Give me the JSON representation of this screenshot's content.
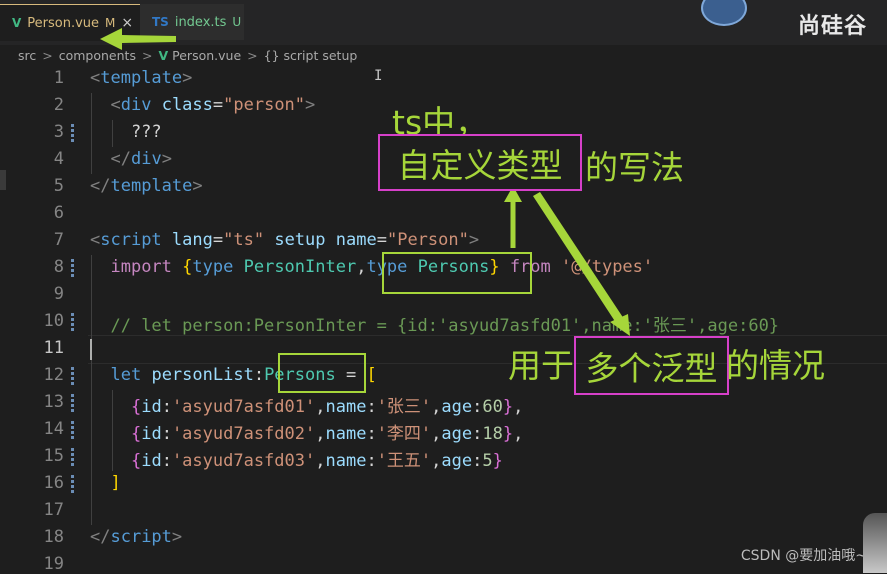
{
  "tabs": [
    {
      "icon": "V",
      "label": "Person.vue",
      "status": "M",
      "close": "×"
    },
    {
      "icon": "TS",
      "label": "index.ts",
      "status": "U"
    }
  ],
  "brand": "尚硅谷",
  "breadcrumb": {
    "items": [
      "src",
      "components",
      "Person.vue",
      "script setup"
    ],
    "separator": ">",
    "braces": "{}"
  },
  "editor": {
    "current_line": 11,
    "line_numbers": [
      "1",
      "2",
      "3",
      "4",
      "5",
      "6",
      "7",
      "8",
      "9",
      "10",
      "11",
      "12",
      "13",
      "14",
      "15",
      "16",
      "17",
      "18",
      "19"
    ],
    "lines": [
      [
        [
          "punc",
          "<"
        ],
        [
          "tag",
          "template"
        ],
        [
          "punc",
          ">"
        ]
      ],
      [
        [
          "txt",
          "  "
        ],
        [
          "punc",
          "<"
        ],
        [
          "tag",
          "div"
        ],
        [
          "txt",
          " "
        ],
        [
          "attr",
          "class"
        ],
        [
          "txt",
          "="
        ],
        [
          "str",
          "\"person\""
        ],
        [
          "punc",
          ">"
        ]
      ],
      [
        [
          "txt",
          "    ???"
        ]
      ],
      [
        [
          "txt",
          "  "
        ],
        [
          "punc",
          "</"
        ],
        [
          "tag",
          "div"
        ],
        [
          "punc",
          ">"
        ]
      ],
      [
        [
          "punc",
          "</"
        ],
        [
          "tag",
          "template"
        ],
        [
          "punc",
          ">"
        ]
      ],
      [],
      [
        [
          "punc",
          "<"
        ],
        [
          "tag",
          "script"
        ],
        [
          "txt",
          " "
        ],
        [
          "attr",
          "lang"
        ],
        [
          "txt",
          "="
        ],
        [
          "str",
          "\"ts\""
        ],
        [
          "txt",
          " "
        ],
        [
          "attr",
          "setup"
        ],
        [
          "txt",
          " "
        ],
        [
          "attr",
          "name"
        ],
        [
          "txt",
          "="
        ],
        [
          "str",
          "\"Person\""
        ],
        [
          "punc",
          ">"
        ]
      ],
      [
        [
          "txt",
          "  "
        ],
        [
          "kw",
          "import"
        ],
        [
          "txt",
          " "
        ],
        [
          "br1",
          "{"
        ],
        [
          "kw2",
          "type"
        ],
        [
          "txt",
          " "
        ],
        [
          "type",
          "PersonInter"
        ],
        [
          "txt",
          ","
        ],
        [
          "kw2",
          "type"
        ],
        [
          "txt",
          " "
        ],
        [
          "type",
          "Persons"
        ],
        [
          "br1",
          "}"
        ],
        [
          "txt",
          " "
        ],
        [
          "kw",
          "from"
        ],
        [
          "txt",
          " "
        ],
        [
          "str",
          "'@/types'"
        ]
      ],
      [],
      [
        [
          "txt",
          "  "
        ],
        [
          "com",
          "// let person:PersonInter = {id:'asyud7asfd01',name:'张三',age:60}"
        ]
      ],
      [],
      [
        [
          "txt",
          "  "
        ],
        [
          "kw2",
          "let"
        ],
        [
          "txt",
          " "
        ],
        [
          "id",
          "personList"
        ],
        [
          "txt",
          ":"
        ],
        [
          "type",
          "Persons"
        ],
        [
          "txt",
          " = "
        ],
        [
          "br1",
          "["
        ]
      ],
      [
        [
          "txt",
          "    "
        ],
        [
          "br2",
          "{"
        ],
        [
          "id",
          "id"
        ],
        [
          "txt",
          ":"
        ],
        [
          "str",
          "'asyud7asfd01'"
        ],
        [
          "txt",
          ","
        ],
        [
          "id",
          "name"
        ],
        [
          "txt",
          ":"
        ],
        [
          "str",
          "'张三'"
        ],
        [
          "txt",
          ","
        ],
        [
          "id",
          "age"
        ],
        [
          "txt",
          ":"
        ],
        [
          "num",
          "60"
        ],
        [
          "br2",
          "}"
        ],
        [
          "txt",
          ","
        ]
      ],
      [
        [
          "txt",
          "    "
        ],
        [
          "br2",
          "{"
        ],
        [
          "id",
          "id"
        ],
        [
          "txt",
          ":"
        ],
        [
          "str",
          "'asyud7asfd02'"
        ],
        [
          "txt",
          ","
        ],
        [
          "id",
          "name"
        ],
        [
          "txt",
          ":"
        ],
        [
          "str",
          "'李四'"
        ],
        [
          "txt",
          ","
        ],
        [
          "id",
          "age"
        ],
        [
          "txt",
          ":"
        ],
        [
          "num",
          "18"
        ],
        [
          "br2",
          "}"
        ],
        [
          "txt",
          ","
        ]
      ],
      [
        [
          "txt",
          "    "
        ],
        [
          "br2",
          "{"
        ],
        [
          "id",
          "id"
        ],
        [
          "txt",
          ":"
        ],
        [
          "str",
          "'asyud7asfd03'"
        ],
        [
          "txt",
          ","
        ],
        [
          "id",
          "name"
        ],
        [
          "txt",
          ":"
        ],
        [
          "str",
          "'王五'"
        ],
        [
          "txt",
          ","
        ],
        [
          "id",
          "age"
        ],
        [
          "txt",
          ":"
        ],
        [
          "num",
          "5"
        ],
        [
          "br2",
          "}"
        ]
      ],
      [
        [
          "txt",
          "  "
        ],
        [
          "br1",
          "]"
        ]
      ],
      [],
      [
        [
          "punc",
          "</"
        ],
        [
          "tag",
          "script"
        ],
        [
          "punc",
          ">"
        ]
      ],
      []
    ],
    "modified_lines": [
      3,
      8,
      10,
      12,
      13,
      14,
      15,
      16
    ]
  },
  "annotations": {
    "ts_title": "ts中，",
    "custom_type": "自定义类型",
    "writing": "的写法",
    "used_for": "用于",
    "multi_generic": "多个泛型",
    "situation": "的情况"
  },
  "watermark": "CSDN @要加油哦~",
  "colors": {
    "annotation_text": "#a6d63a",
    "highlight_box_magenta": "#d640c9",
    "highlight_box_green": "#a6d63a",
    "arrow": "#a6d63a"
  }
}
